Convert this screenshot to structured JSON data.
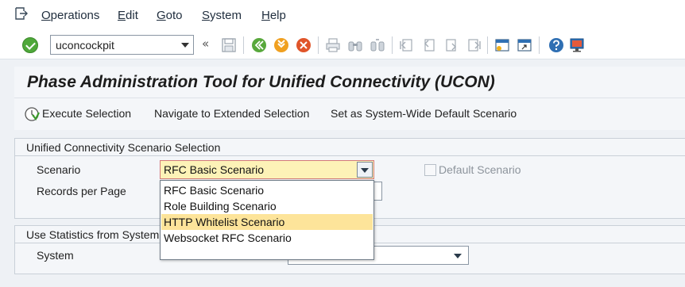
{
  "menu": {
    "items": [
      {
        "first": "O",
        "rest": "perations"
      },
      {
        "first": "E",
        "rest": "dit"
      },
      {
        "first": "G",
        "rest": "oto"
      },
      {
        "first": "S",
        "rest": "ystem"
      },
      {
        "first": "H",
        "rest": "elp"
      }
    ]
  },
  "toolbar": {
    "command_value": "uconcockpit",
    "back_glyph": "«"
  },
  "title": "Phase Administration Tool for Unified Connectivity (UCON)",
  "app_toolbar": {
    "execute": "Execute Selection",
    "navigate": "Navigate to Extended Selection",
    "set_default": "Set as System-Wide Default Scenario"
  },
  "selection_group": {
    "title": "Unified Connectivity Scenario Selection",
    "scenario_label": "Scenario",
    "scenario_value": "RFC Basic Scenario",
    "records_label": "Records per Page",
    "default_checkbox_label": "Default Scenario",
    "default_checked": false
  },
  "scenario_options": [
    "RFC Basic Scenario",
    "Role Building Scenario",
    "HTTP Whitelist Scenario",
    "Websocket RFC Scenario"
  ],
  "statistics_group": {
    "title": "Use Statistics from System",
    "system_label": "System",
    "system_value": ""
  },
  "colors": {
    "hover_item": "#fde49a",
    "scenario_field": "#fdf2b7",
    "ok_green": "#4fa83a"
  }
}
